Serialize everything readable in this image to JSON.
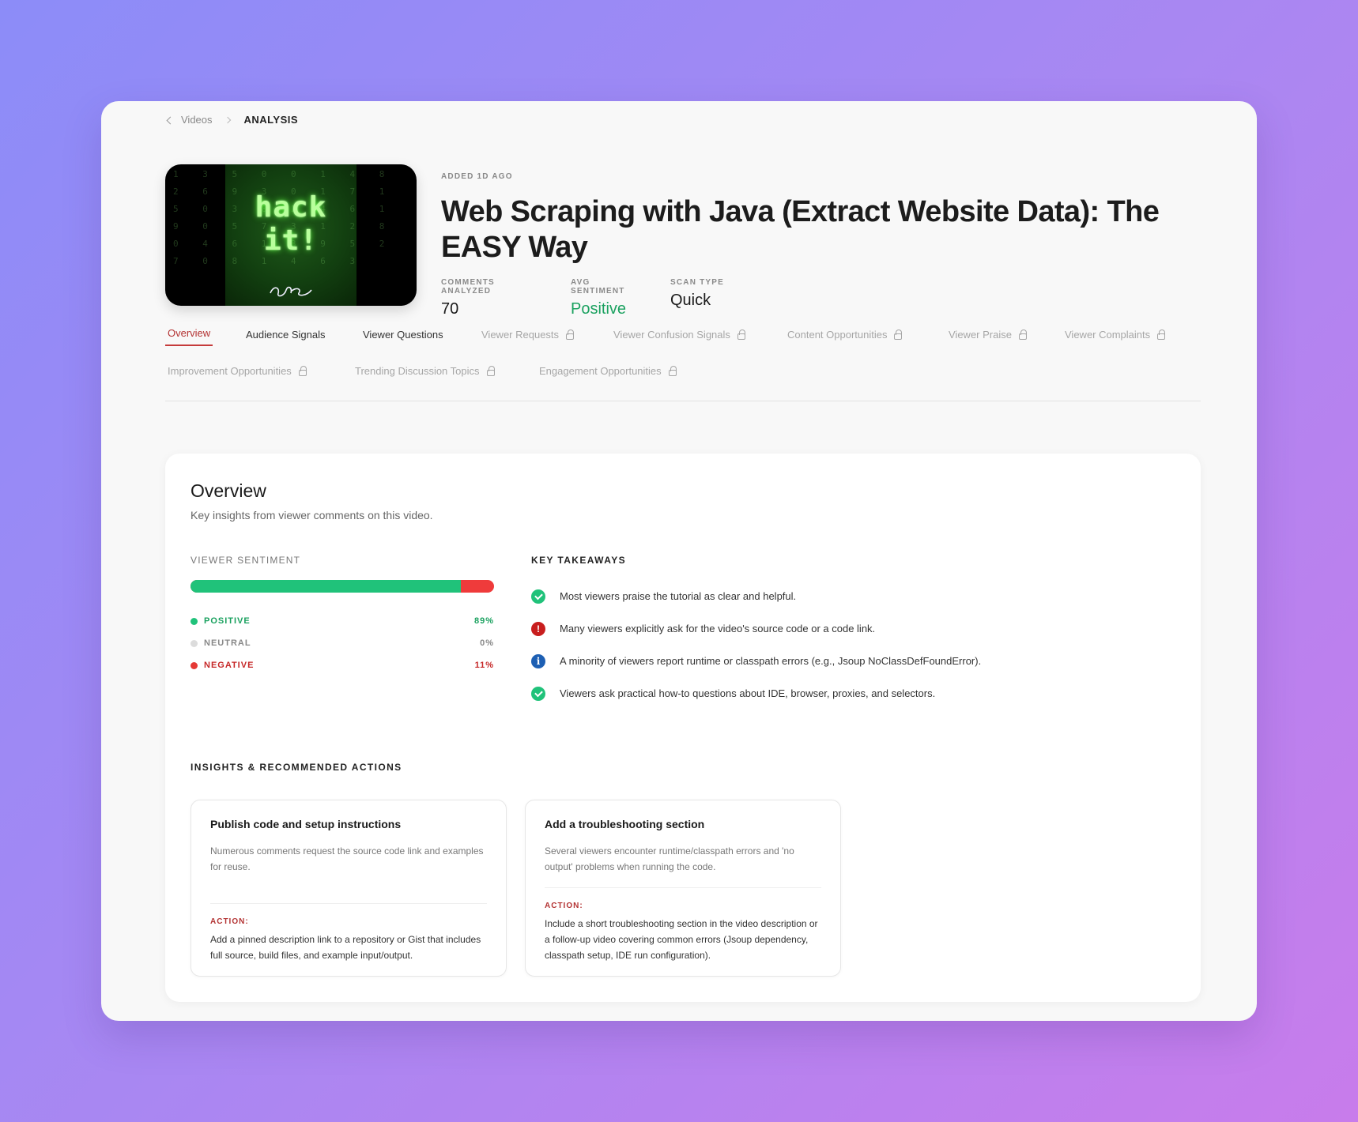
{
  "breadcrumb": {
    "back": "Videos",
    "current": "ANALYSIS"
  },
  "video": {
    "added": "ADDED 1D AGO",
    "title": "Web Scraping with Java (Extract Website Data): The EASY Way",
    "thumbnail_text_line1": "hack",
    "thumbnail_text_line2": "it!"
  },
  "stats": [
    {
      "label": "COMMENTS ANALYZED",
      "value": "70"
    },
    {
      "label": "AVG SENTIMENT",
      "value": "Positive"
    },
    {
      "label": "SCAN TYPE",
      "value": "Quick"
    }
  ],
  "tabs": [
    {
      "label": "Overview",
      "state": "active"
    },
    {
      "label": "Audience Signals",
      "state": "open"
    },
    {
      "label": "Viewer Questions",
      "state": "open"
    },
    {
      "label": "Viewer Requests",
      "state": "locked"
    },
    {
      "label": "Viewer Confusion Signals",
      "state": "locked"
    },
    {
      "label": "Content Opportunities",
      "state": "locked"
    },
    {
      "label": "Viewer Praise",
      "state": "locked"
    },
    {
      "label": "Viewer Complaints",
      "state": "locked"
    },
    {
      "label": "Improvement Opportunities",
      "state": "locked"
    },
    {
      "label": "Trending Discussion Topics",
      "state": "locked"
    },
    {
      "label": "Engagement Opportunities",
      "state": "locked"
    }
  ],
  "overview": {
    "title": "Overview",
    "subtitle": "Key insights from viewer comments on this video."
  },
  "sentiment": {
    "label": "VIEWER SENTIMENT",
    "positive_fraction": 0.89,
    "items": [
      {
        "name": "POSITIVE",
        "pct": "89%",
        "color": "#1aa15f",
        "dot": "#20c27a"
      },
      {
        "name": "NEUTRAL",
        "pct": "0%",
        "color": "#888888",
        "dot": "#dcdcdc"
      },
      {
        "name": "NEGATIVE",
        "pct": "11%",
        "color": "#c62828",
        "dot": "#e53935"
      }
    ]
  },
  "takeaways": {
    "label": "KEY TAKEAWAYS",
    "items": [
      {
        "icon": "check",
        "text": "Most viewers praise the tutorial as clear and helpful."
      },
      {
        "icon": "alert",
        "text": "Many viewers explicitly ask for the video's source code or a code link."
      },
      {
        "icon": "info",
        "text": "A minority of viewers report runtime or classpath errors (e.g., Jsoup NoClassDefFoundError)."
      },
      {
        "icon": "check",
        "text": "Viewers ask practical how-to questions about IDE, browser, proxies, and selectors."
      }
    ]
  },
  "insights": {
    "label": "INSIGHTS & RECOMMENDED ACTIONS",
    "cards": [
      {
        "title": "Publish code and setup instructions",
        "description": "Numerous comments request the source code link and examples for reuse.",
        "action_label": "ACTION:",
        "action": "Add a pinned description link to a repository or Gist that includes full source, build files, and example input/output."
      },
      {
        "title": "Add a troubleshooting section",
        "description": "Several viewers encounter runtime/classpath errors and 'no output' problems when running the code.",
        "action_label": "ACTION:",
        "action": "Include a short troubleshooting section in the video description or a follow-up video covering common errors (Jsoup dependency, classpath setup, IDE run configuration)."
      }
    ]
  }
}
